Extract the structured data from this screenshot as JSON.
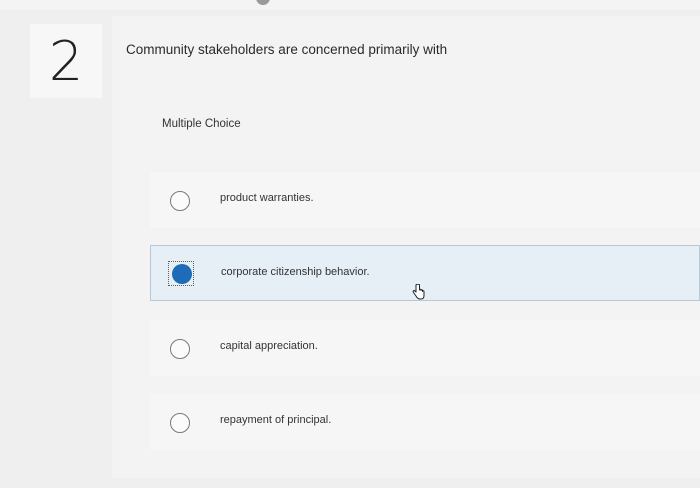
{
  "question": {
    "number": "2",
    "text": "Community stakeholders are concerned primarily with",
    "answer_type": "Multiple Choice"
  },
  "options": [
    {
      "label": "product warranties.",
      "selected": false
    },
    {
      "label": "corporate citizenship behavior.",
      "selected": true
    },
    {
      "label": "capital appreciation.",
      "selected": false
    },
    {
      "label": "repayment of principal.",
      "selected": false
    }
  ],
  "colors": {
    "selected_fill": "#1e6bb8",
    "selected_row_bg": "#e7eff6",
    "page_bg": "#efefef"
  },
  "icons": {
    "cursor": "hand-pointer-icon"
  }
}
